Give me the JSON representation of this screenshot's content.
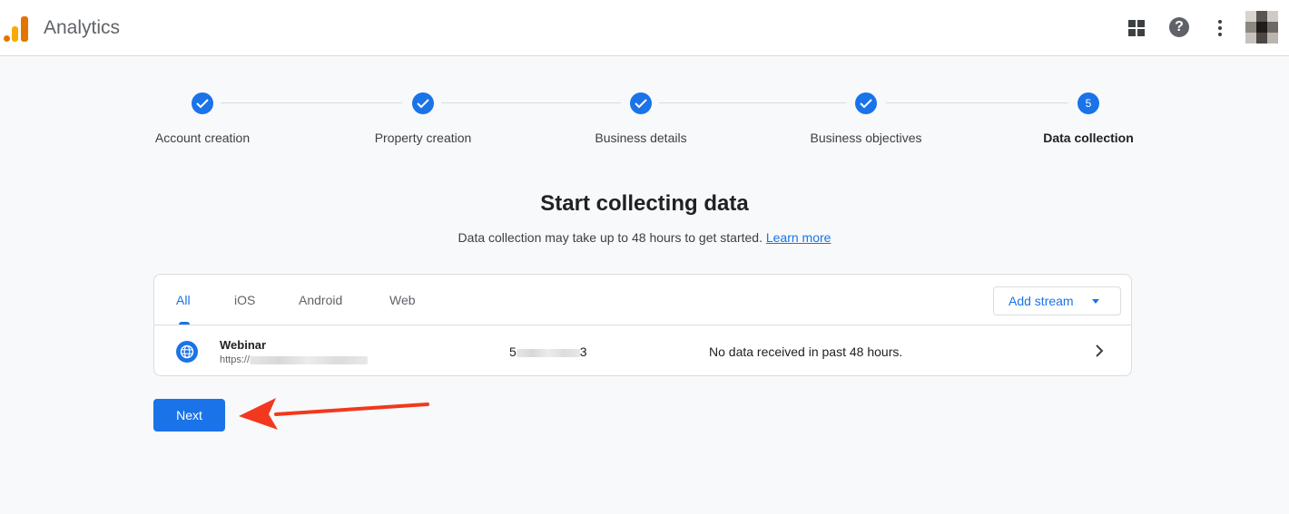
{
  "header": {
    "app_title": "Analytics",
    "icons": [
      "analytics-logo-icon",
      "apps-grid-icon",
      "help-icon",
      "more-vert-icon",
      "avatar"
    ]
  },
  "stepper": {
    "steps": [
      {
        "label": "Account creation",
        "state": "done"
      },
      {
        "label": "Property creation",
        "state": "done"
      },
      {
        "label": "Business details",
        "state": "done"
      },
      {
        "label": "Business objectives",
        "state": "done"
      },
      {
        "label": "Data collection",
        "state": "active",
        "number": "5"
      }
    ]
  },
  "main": {
    "title": "Start collecting data",
    "subtitle": "Data collection may take up to 48 hours to get started.",
    "learn_more": "Learn more"
  },
  "streams_card": {
    "tabs": [
      "All",
      "iOS",
      "Android",
      "Web"
    ],
    "active_tab": "All",
    "add_stream_label": "Add stream",
    "rows": [
      {
        "name": "Webinar",
        "url_prefix": "https://",
        "id_start": "5",
        "id_end": "3",
        "status": "No data received in past 48 hours."
      }
    ]
  },
  "actions": {
    "next_label": "Next"
  },
  "colors": {
    "primary": "#1a73e8",
    "annotation_arrow": "#f2381e",
    "logo_orange": "#e37400",
    "logo_yellow": "#f9ab00"
  }
}
